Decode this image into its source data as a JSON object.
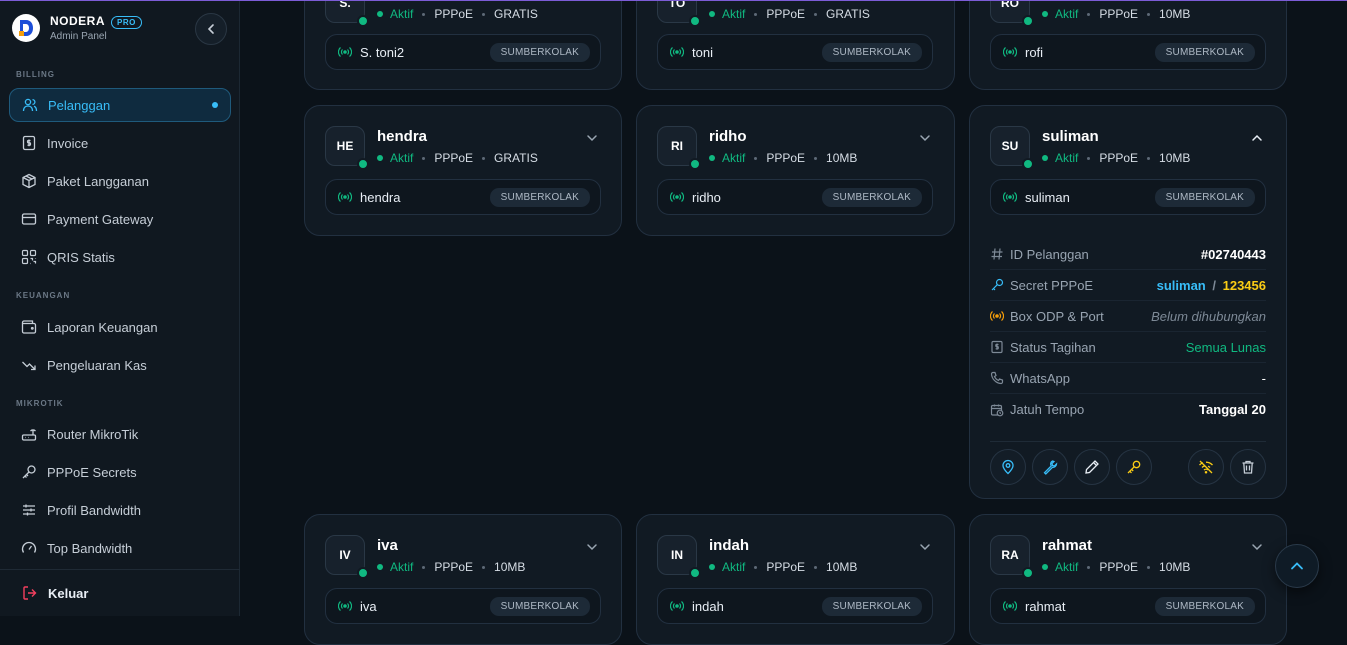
{
  "app": {
    "name": "NODERA",
    "badge": "PRO",
    "subtitle": "Admin Panel"
  },
  "sidebar": {
    "sections": {
      "billing": "BILLING",
      "keuangan": "KEUANGAN",
      "mikrotik": "MIKROTIK"
    },
    "items": [
      {
        "label": "Pelanggan",
        "icon": "users-icon"
      },
      {
        "label": "Invoice",
        "icon": "invoice-icon"
      },
      {
        "label": "Paket Langganan",
        "icon": "package-icon"
      },
      {
        "label": "Payment Gateway",
        "icon": "card-icon"
      },
      {
        "label": "QRIS Statis",
        "icon": "qr-icon"
      },
      {
        "label": "Laporan Keuangan",
        "icon": "wallet-icon"
      },
      {
        "label": "Pengeluaran Kas",
        "icon": "trend-down-icon"
      },
      {
        "label": "Router MikroTik",
        "icon": "router-icon"
      },
      {
        "label": "PPPoE Secrets",
        "icon": "key-icon"
      },
      {
        "label": "Profil Bandwidth",
        "icon": "sliders-icon"
      },
      {
        "label": "Top Bandwidth",
        "icon": "gauge-icon"
      }
    ],
    "logout": "Keluar"
  },
  "colors": {
    "accent": "#38bdf8",
    "active": "#10b981",
    "warning": "#facc15",
    "background": "#0b1219"
  },
  "customers": [
    {
      "initials": "S.",
      "name": "",
      "status": "Aktif",
      "type": "PPPoE",
      "plan": "GRATIS",
      "pppoe": "S. toni2",
      "area": "SUMBERKOLAK"
    },
    {
      "initials": "TO",
      "name": "",
      "status": "Aktif",
      "type": "PPPoE",
      "plan": "GRATIS",
      "pppoe": "toni",
      "area": "SUMBERKOLAK"
    },
    {
      "initials": "RO",
      "name": "",
      "status": "Aktif",
      "type": "PPPoE",
      "plan": "10MB",
      "pppoe": "rofi",
      "area": "SUMBERKOLAK"
    },
    {
      "initials": "HE",
      "name": "hendra",
      "status": "Aktif",
      "type": "PPPoE",
      "plan": "GRATIS",
      "pppoe": "hendra",
      "area": "SUMBERKOLAK"
    },
    {
      "initials": "RI",
      "name": "ridho",
      "status": "Aktif",
      "type": "PPPoE",
      "plan": "10MB",
      "pppoe": "ridho",
      "area": "SUMBERKOLAK"
    },
    {
      "initials": "SU",
      "name": "suliman",
      "status": "Aktif",
      "type": "PPPoE",
      "plan": "10MB",
      "pppoe": "suliman",
      "area": "SUMBERKOLAK"
    },
    {
      "initials": "IV",
      "name": "iva",
      "status": "Aktif",
      "type": "PPPoE",
      "plan": "10MB",
      "pppoe": "iva",
      "area": "SUMBERKOLAK"
    },
    {
      "initials": "IN",
      "name": "indah",
      "status": "Aktif",
      "type": "PPPoE",
      "plan": "10MB",
      "pppoe": "indah",
      "area": "SUMBERKOLAK"
    },
    {
      "initials": "RA",
      "name": "rahmat",
      "status": "Aktif",
      "type": "PPPoE",
      "plan": "10MB",
      "pppoe": "rahmat",
      "area": "SUMBERKOLAK"
    }
  ],
  "detail": {
    "id_label": "ID Pelanggan",
    "id_value": "#02740443",
    "secret_label": "Secret PPPoE",
    "secret_user": "suliman",
    "secret_sep": "/",
    "secret_pass": "123456",
    "odp_label": "Box ODP & Port",
    "odp_value": "Belum dihubungkan",
    "billing_label": "Status Tagihan",
    "billing_value": "Semua Lunas",
    "wa_label": "WhatsApp",
    "wa_value": "-",
    "due_label": "Jatuh Tempo",
    "due_value": "Tanggal 20"
  }
}
